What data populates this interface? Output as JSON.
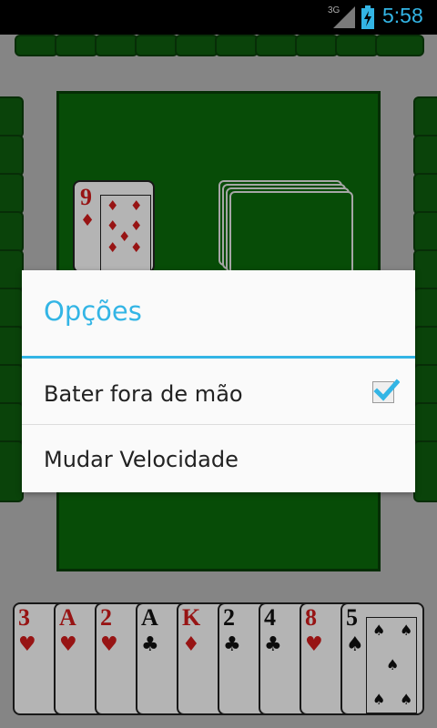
{
  "status_bar": {
    "network": "3G",
    "time": "5:58",
    "accent": "#33b5e5"
  },
  "table": {
    "color": "#0a6a0a"
  },
  "discard": {
    "rank": "9",
    "suit": "♦"
  },
  "hand": [
    {
      "rank": "3",
      "suit": "♥",
      "color": "red"
    },
    {
      "rank": "A",
      "suit": "♥",
      "color": "red"
    },
    {
      "rank": "2",
      "suit": "♥",
      "color": "red"
    },
    {
      "rank": "A",
      "suit": "♣",
      "color": "black"
    },
    {
      "rank": "K",
      "suit": "♦",
      "color": "red"
    },
    {
      "rank": "2",
      "suit": "♣",
      "color": "black"
    },
    {
      "rank": "4",
      "suit": "♣",
      "color": "black"
    },
    {
      "rank": "8",
      "suit": "♥",
      "color": "red"
    },
    {
      "rank": "5",
      "suit": "♠",
      "color": "black"
    }
  ],
  "dialog": {
    "title": "Opções",
    "options": [
      {
        "label": "Bater fora de mão",
        "checked": true
      },
      {
        "label": "Mudar Velocidade"
      }
    ]
  }
}
